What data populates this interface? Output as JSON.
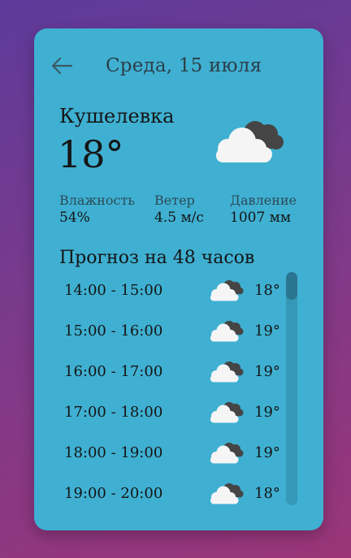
{
  "header": {
    "back_icon": "arrow-left-icon",
    "date": "Среда, 15 июля"
  },
  "current": {
    "city": "Кушелевка",
    "temperature": "18°",
    "icon": "cloudy-icon"
  },
  "stats": [
    {
      "label": "Влажность",
      "value": "54%"
    },
    {
      "label": "Ветер",
      "value": "4.5 м/с"
    },
    {
      "label": "Давление",
      "value": "1007 мм"
    }
  ],
  "forecast": {
    "title": "Прогноз на 48 часов",
    "rows": [
      {
        "time": "14:00 - 15:00",
        "icon": "cloudy-icon",
        "temp": "18°"
      },
      {
        "time": "15:00 - 16:00",
        "icon": "cloudy-icon",
        "temp": "19°"
      },
      {
        "time": "16:00 - 17:00",
        "icon": "cloudy-icon",
        "temp": "19°"
      },
      {
        "time": "17:00 - 18:00",
        "icon": "cloudy-icon",
        "temp": "19°"
      },
      {
        "time": "18:00 - 19:00",
        "icon": "cloudy-icon",
        "temp": "19°"
      },
      {
        "time": "19:00 - 20:00",
        "icon": "cloudy-icon",
        "temp": "18°"
      }
    ]
  },
  "colors": {
    "card": "#3fb0d2",
    "cloud_front": "#f5f5f5",
    "cloud_back": "#454545"
  }
}
